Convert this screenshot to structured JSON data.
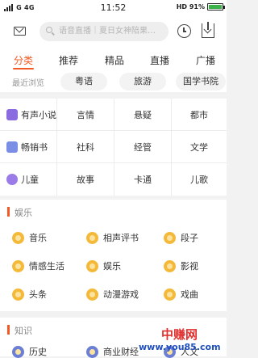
{
  "status": {
    "left": "G 4G",
    "time": "11:52",
    "right": "HD 91%"
  },
  "search": {
    "placeholder": "语音直播｜夏日女神陪果…"
  },
  "tabs": [
    "分类",
    "推荐",
    "精品",
    "直播",
    "广播"
  ],
  "recent": {
    "label": "最近浏览",
    "chips": [
      "粤语",
      "旅游",
      "国学书院"
    ]
  },
  "grid": {
    "rows": [
      [
        "有声小说",
        "言情",
        "悬疑",
        "都市"
      ],
      [
        "畅销书",
        "社科",
        "经管",
        "文学"
      ],
      [
        "儿童",
        "故事",
        "卡通",
        "儿歌"
      ]
    ]
  },
  "sections": [
    {
      "title": "娱乐",
      "items": [
        [
          "音乐",
          "相声评书",
          "段子"
        ],
        [
          "情感生活",
          "娱乐",
          "影视"
        ],
        [
          "头条",
          "动漫游戏",
          "戏曲"
        ]
      ]
    },
    {
      "title": "知识",
      "items": [
        [
          "历史",
          "商业财经",
          "人文"
        ]
      ]
    }
  ],
  "watermark": {
    "cn": "中赚网",
    "url": "www.you85.com"
  },
  "colors": {
    "accent": "#f15a24",
    "icon_orange": "#f5b93a"
  }
}
